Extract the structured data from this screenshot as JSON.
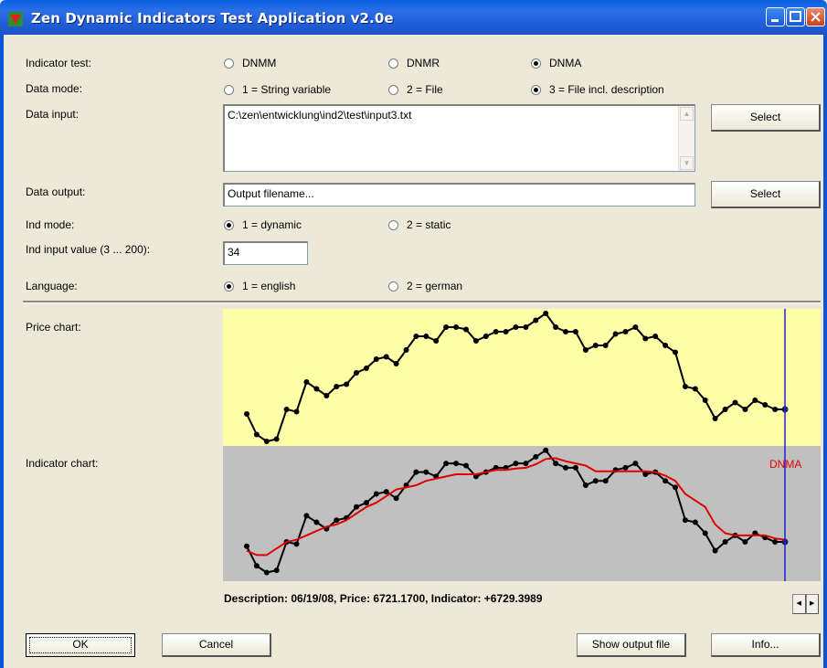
{
  "window": {
    "title": "Zen Dynamic Indicators Test Application v2.0e"
  },
  "labels": {
    "indicator_test": "Indicator test:",
    "data_mode": "Data mode:",
    "data_input": "Data input:",
    "data_output": "Data output:",
    "ind_mode": "Ind mode:",
    "ind_input_value": "Ind input value (3 ... 200):",
    "language": "Language:",
    "price_chart": "Price chart:",
    "indicator_chart": "Indicator chart:"
  },
  "indicator_test": {
    "options": [
      "DNMM",
      "DNMR",
      "DNMA"
    ],
    "selected": 2
  },
  "data_mode": {
    "options": [
      "1 = String variable",
      "2 = File",
      "3 = File incl. description"
    ],
    "selected": 2
  },
  "data_input": {
    "value": "C:\\zen\\entwicklung\\ind2\\test\\input3.txt",
    "select_label": "Select"
  },
  "data_output": {
    "value": "Output filename...",
    "select_label": "Select"
  },
  "ind_mode": {
    "options": [
      "1 = dynamic",
      "2 = static"
    ],
    "selected": 0
  },
  "ind_input_value": "34",
  "language": {
    "options": [
      "1 = english",
      "2 = german"
    ],
    "selected": 0
  },
  "chart_data": [
    {
      "type": "line",
      "title": "",
      "background": "#ffffa8",
      "series": [
        {
          "values": [
            6550,
            6505,
            6490,
            6495,
            6560,
            6555,
            6620,
            6605,
            6590,
            6610,
            6615,
            6640,
            6650,
            6670,
            6675,
            6660,
            6690,
            6720,
            6720,
            6710,
            6740,
            6740,
            6735,
            6710,
            6720,
            6730,
            6730,
            6740,
            6740,
            6755,
            6770,
            6740,
            6730,
            6730,
            6690,
            6700,
            6700,
            6725,
            6730,
            6740,
            6715,
            6720,
            6700,
            6685,
            6610,
            6605,
            6580,
            6540,
            6560,
            6575,
            6560,
            6580,
            6570,
            6560,
            6560
          ],
          "color": "#000000"
        }
      ],
      "ylim": [
        6480,
        6780
      ]
    },
    {
      "type": "line",
      "title": "",
      "background": "#c0c0c0",
      "series_label": "DNMA",
      "series": [
        {
          "values": [
            6550,
            6505,
            6490,
            6495,
            6560,
            6555,
            6620,
            6605,
            6590,
            6610,
            6615,
            6640,
            6650,
            6670,
            6675,
            6660,
            6690,
            6720,
            6720,
            6710,
            6740,
            6740,
            6735,
            6710,
            6720,
            6730,
            6730,
            6740,
            6740,
            6755,
            6770,
            6740,
            6730,
            6730,
            6690,
            6700,
            6700,
            6725,
            6730,
            6740,
            6715,
            6720,
            6700,
            6685,
            6610,
            6605,
            6580,
            6540,
            6560,
            6575,
            6560,
            6580,
            6570,
            6560,
            6560
          ],
          "color": "#000000"
        },
        {
          "name": "DNMA",
          "values": [
            6540,
            6530,
            6530,
            6545,
            6560,
            6565,
            6575,
            6585,
            6595,
            6600,
            6610,
            6625,
            6640,
            6650,
            6665,
            6680,
            6685,
            6690,
            6700,
            6705,
            6710,
            6715,
            6715,
            6715,
            6720,
            6725,
            6725,
            6728,
            6730,
            6738,
            6750,
            6752,
            6745,
            6740,
            6735,
            6722,
            6722,
            6722,
            6722,
            6722,
            6722,
            6720,
            6712,
            6700,
            6670,
            6655,
            6640,
            6600,
            6580,
            6575,
            6575,
            6575,
            6575,
            6568,
            6565
          ],
          "color": "#e00000"
        }
      ],
      "ylim": [
        6470,
        6780
      ]
    }
  ],
  "description": "Description: 06/19/08,  Price: 6721.1700,  Indicator: +6729.3989",
  "buttons": {
    "ok": "OK",
    "cancel": "Cancel",
    "show_output": "Show output file",
    "info": "Info..."
  }
}
